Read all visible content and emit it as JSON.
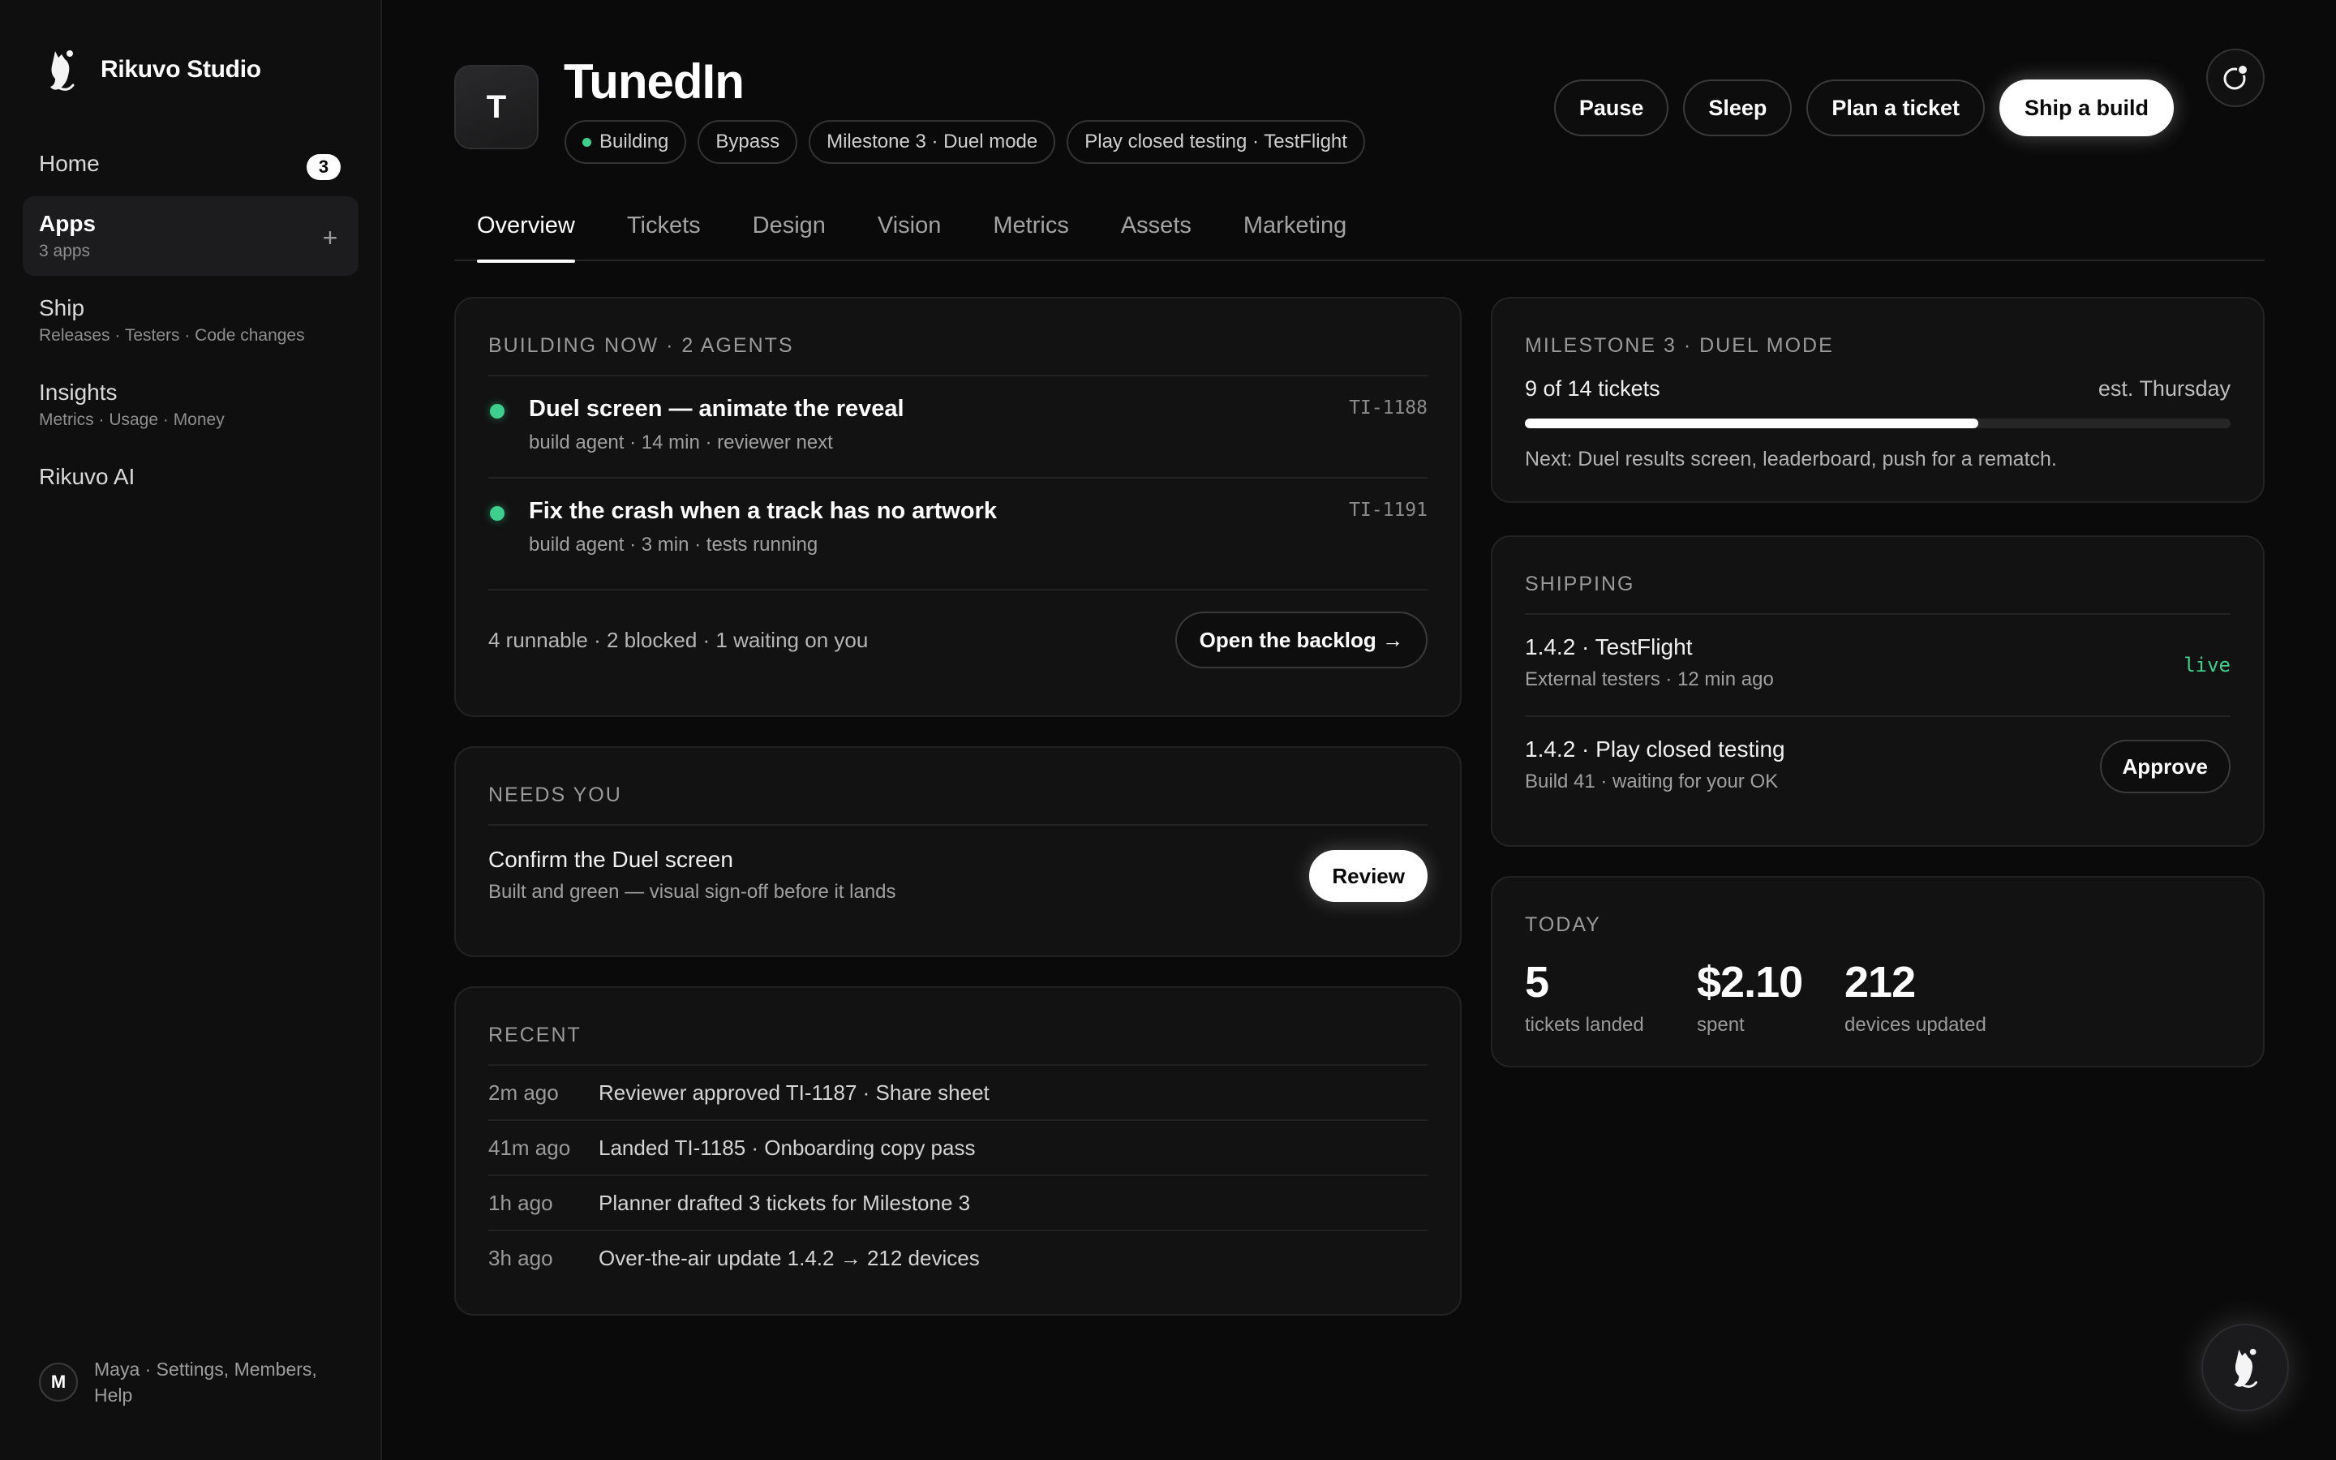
{
  "brand": {
    "name": "Rikuvo Studio",
    "logo_icon": "cat-logo-icon"
  },
  "sidebar": {
    "items": [
      {
        "label": "Home",
        "badge": "3",
        "sub": ""
      },
      {
        "label": "Apps",
        "sub": "3 apps",
        "action": "+"
      },
      {
        "label": "Ship",
        "sub": "Releases · Testers · Code changes"
      },
      {
        "label": "Insights",
        "sub": "Metrics · Usage · Money"
      },
      {
        "label": "Rikuvo AI",
        "sub": ""
      }
    ],
    "user": {
      "initial": "M",
      "text": "Maya · Settings, Members, Help"
    }
  },
  "app": {
    "icon_letter": "T",
    "title": "TunedIn",
    "chips": [
      {
        "label": "Building",
        "dot_color": "#3ecf8e"
      },
      {
        "label": "Bypass"
      },
      {
        "label": "Milestone 3 · Duel mode"
      },
      {
        "label": "Play closed testing · TestFlight"
      }
    ]
  },
  "actions": {
    "pause": "Pause",
    "sleep": "Sleep",
    "plan": "Plan a ticket",
    "ship": "Ship a build"
  },
  "tabs": [
    "Overview",
    "Tickets",
    "Design",
    "Vision",
    "Metrics",
    "Assets",
    "Marketing"
  ],
  "active_tab": "Overview",
  "building": {
    "title": "BUILDING NOW · 2 AGENTS",
    "tasks": [
      {
        "title": "Duel screen — animate the reveal",
        "meta": "build agent · 14 min · reviewer next",
        "id": "TI-1188"
      },
      {
        "title": "Fix the crash when a track has no artwork",
        "meta": "build agent · 3 min · tests running",
        "id": "TI-1191"
      }
    ],
    "footer": "4 runnable · 2 blocked · 1 waiting on you",
    "backlog_button": "Open the backlog →"
  },
  "needs_you": {
    "title": "NEEDS YOU",
    "item_title": "Confirm the Duel screen",
    "item_sub": "Built and green — visual sign-off before it lands",
    "button": "Review"
  },
  "recent": {
    "title": "RECENT",
    "rows": [
      {
        "time": "2m ago",
        "text": "Reviewer approved TI-1187 · Share sheet"
      },
      {
        "time": "41m ago",
        "text": "Landed TI-1185 · Onboarding copy pass"
      },
      {
        "time": "1h ago",
        "text": "Planner drafted 3 tickets for Milestone 3"
      },
      {
        "time": "3h ago",
        "text": "Over-the-air update 1.4.2 → 212 devices"
      }
    ]
  },
  "milestone": {
    "title": "MILESTONE 3 · DUEL MODE",
    "progress_text": "9 of 14 tickets",
    "progress_done": 9,
    "progress_total": 14,
    "eta": "est. Thursday",
    "next": "Next: Duel results screen, leaderboard, push for a rematch."
  },
  "shipping": {
    "title": "SHIPPING",
    "rows": [
      {
        "title": "1.4.2 · TestFlight",
        "sub": "External testers · 12 min ago",
        "status": "live",
        "status_color": "#3ecf8e"
      },
      {
        "title": "1.4.2 · Play closed testing",
        "sub": "Build 41 · waiting for your OK",
        "button": "Approve"
      }
    ]
  },
  "today": {
    "title": "TODAY",
    "stats": [
      {
        "value": "5",
        "label": "tickets landed"
      },
      {
        "value": "$2.10",
        "label": "spent"
      },
      {
        "value": "212",
        "label": "devices updated"
      }
    ]
  }
}
